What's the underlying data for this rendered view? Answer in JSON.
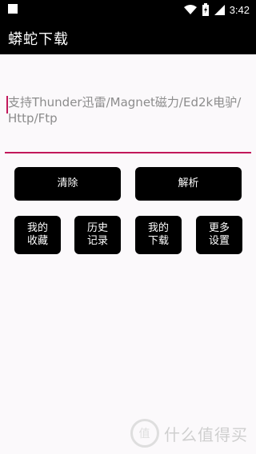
{
  "status": {
    "time": "3:42"
  },
  "app": {
    "title": "蟒蛇下载"
  },
  "input": {
    "placeholder": "支持Thunder迅雷/Magnet磁力/Ed2k电驴/Http/Ftp"
  },
  "buttons": {
    "clear": "清除",
    "parse": "解析",
    "favorites": "我的收藏",
    "history": "历史记录",
    "downloads": "我的下载",
    "settings": "更多设置"
  },
  "watermark": {
    "icon": "值",
    "text": "什么值得买"
  },
  "colors": {
    "accent": "#c2185b",
    "button_bg": "#000000"
  }
}
